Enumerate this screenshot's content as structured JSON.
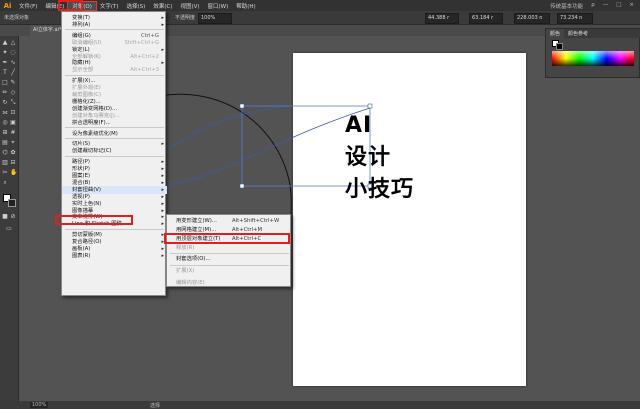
{
  "app": {
    "logo": "Ai"
  },
  "menubar": {
    "items": [
      "文件(F)",
      "编辑(E)",
      "对象(O)",
      "文字(T)",
      "选择(S)",
      "效果(C)",
      "视图(V)",
      "窗口(W)",
      "帮助(H)"
    ],
    "active_index": 2,
    "right": [
      "传统基本功能",
      "ρ",
      "—",
      "□",
      "×"
    ]
  },
  "control_bar": {
    "left_label": "未选择对象",
    "opacity_label": "不透明度",
    "opacity_value": "100%",
    "x_value": "44.388 r",
    "y_value": "63.184 r",
    "w_value": "228.003 n",
    "h_value": "73.234 n"
  },
  "tab": {
    "document": "AI立体字.ai*"
  },
  "status_bar": {
    "zoom": "100%",
    "tool": "选择"
  },
  "panel": {
    "tabs": [
      "颜色",
      "颜色参考"
    ]
  },
  "artboard": {
    "lines": [
      "AI",
      "设计",
      "小技巧"
    ]
  },
  "object_menu": {
    "items": [
      {
        "label": "变换(T)",
        "shortcut": "",
        "submenu": true,
        "disabled": false
      },
      {
        "label": "排列(A)",
        "shortcut": "",
        "submenu": true,
        "disabled": false
      },
      {
        "sep": true
      },
      {
        "label": "编组(G)",
        "shortcut": "Ctrl+G",
        "submenu": false,
        "disabled": false
      },
      {
        "label": "取消编组(U)",
        "shortcut": "Shift+Ctrl+G",
        "submenu": false,
        "disabled": true
      },
      {
        "label": "锁定(L)",
        "shortcut": "",
        "submenu": true,
        "disabled": false
      },
      {
        "label": "全部解锁(K)",
        "shortcut": "Alt+Ctrl+2",
        "submenu": false,
        "disabled": true
      },
      {
        "label": "隐藏(H)",
        "shortcut": "",
        "submenu": true,
        "disabled": false
      },
      {
        "label": "显示全部",
        "shortcut": "Alt+Ctrl+3",
        "submenu": false,
        "disabled": true
      },
      {
        "sep": true
      },
      {
        "label": "扩展(X)...",
        "shortcut": "",
        "submenu": false,
        "disabled": false
      },
      {
        "label": "扩展外观(E)",
        "shortcut": "",
        "submenu": false,
        "disabled": true
      },
      {
        "label": "裁剪图像(C)",
        "shortcut": "",
        "submenu": false,
        "disabled": true
      },
      {
        "label": "栅格化(Z)...",
        "shortcut": "",
        "submenu": false,
        "disabled": false
      },
      {
        "label": "创建渐变网格(D)...",
        "shortcut": "",
        "submenu": false,
        "disabled": false
      },
      {
        "label": "创建对象马赛克(J)...",
        "shortcut": "",
        "submenu": false,
        "disabled": true
      },
      {
        "label": "拼合透明度(F)...",
        "shortcut": "",
        "submenu": false,
        "disabled": false
      },
      {
        "sep": true
      },
      {
        "label": "设为像素级优化(M)",
        "shortcut": "",
        "submenu": false,
        "disabled": false
      },
      {
        "sep": true
      },
      {
        "label": "切片(S)",
        "shortcut": "",
        "submenu": true,
        "disabled": false
      },
      {
        "label": "创建裁切标记(C)",
        "shortcut": "",
        "submenu": false,
        "disabled": false
      },
      {
        "sep": true
      },
      {
        "label": "路径(P)",
        "shortcut": "",
        "submenu": true,
        "disabled": false
      },
      {
        "label": "形状(P)",
        "shortcut": "",
        "submenu": true,
        "disabled": false
      },
      {
        "label": "图案(E)",
        "shortcut": "",
        "submenu": true,
        "disabled": false
      },
      {
        "label": "混合(B)",
        "shortcut": "",
        "submenu": true,
        "disabled": false
      },
      {
        "label": "封套扭曲(V)",
        "shortcut": "",
        "submenu": true,
        "disabled": false,
        "highlight": true
      },
      {
        "label": "透视(P)",
        "shortcut": "",
        "submenu": true,
        "disabled": false
      },
      {
        "label": "实时上色(N)",
        "shortcut": "",
        "submenu": true,
        "disabled": false
      },
      {
        "label": "图像描摹",
        "shortcut": "",
        "submenu": true,
        "disabled": false
      },
      {
        "label": "文本绕排(W)",
        "shortcut": "",
        "submenu": true,
        "disabled": false
      },
      {
        "label": "Line 和 Sketch 图稿",
        "shortcut": "",
        "submenu": true,
        "disabled": false
      },
      {
        "sep": true
      },
      {
        "label": "剪切蒙版(M)",
        "shortcut": "",
        "submenu": true,
        "disabled": false
      },
      {
        "label": "复合路径(O)",
        "shortcut": "",
        "submenu": true,
        "disabled": false
      },
      {
        "label": "画板(A)",
        "shortcut": "",
        "submenu": true,
        "disabled": false
      },
      {
        "label": "图表(R)",
        "shortcut": "",
        "submenu": true,
        "disabled": false
      }
    ]
  },
  "envelope_submenu": {
    "items": [
      {
        "label": "用变形建立(W)...",
        "shortcut": "Alt+Shift+Ctrl+W",
        "disabled": false
      },
      {
        "label": "用网格建立(M)...",
        "shortcut": "Alt+Ctrl+M",
        "disabled": false
      },
      {
        "label": "用顶层对象建立(T)",
        "shortcut": "Alt+Ctrl+C",
        "disabled": false,
        "highlight": true
      },
      {
        "label": "释放(R)",
        "shortcut": "",
        "disabled": true
      },
      {
        "label": "封套选项(O)...",
        "shortcut": "",
        "disabled": false
      },
      {
        "label": "扩展(X)",
        "shortcut": "",
        "disabled": true
      },
      {
        "label": "编辑内容(E)",
        "shortcut": "",
        "disabled": true
      }
    ]
  }
}
